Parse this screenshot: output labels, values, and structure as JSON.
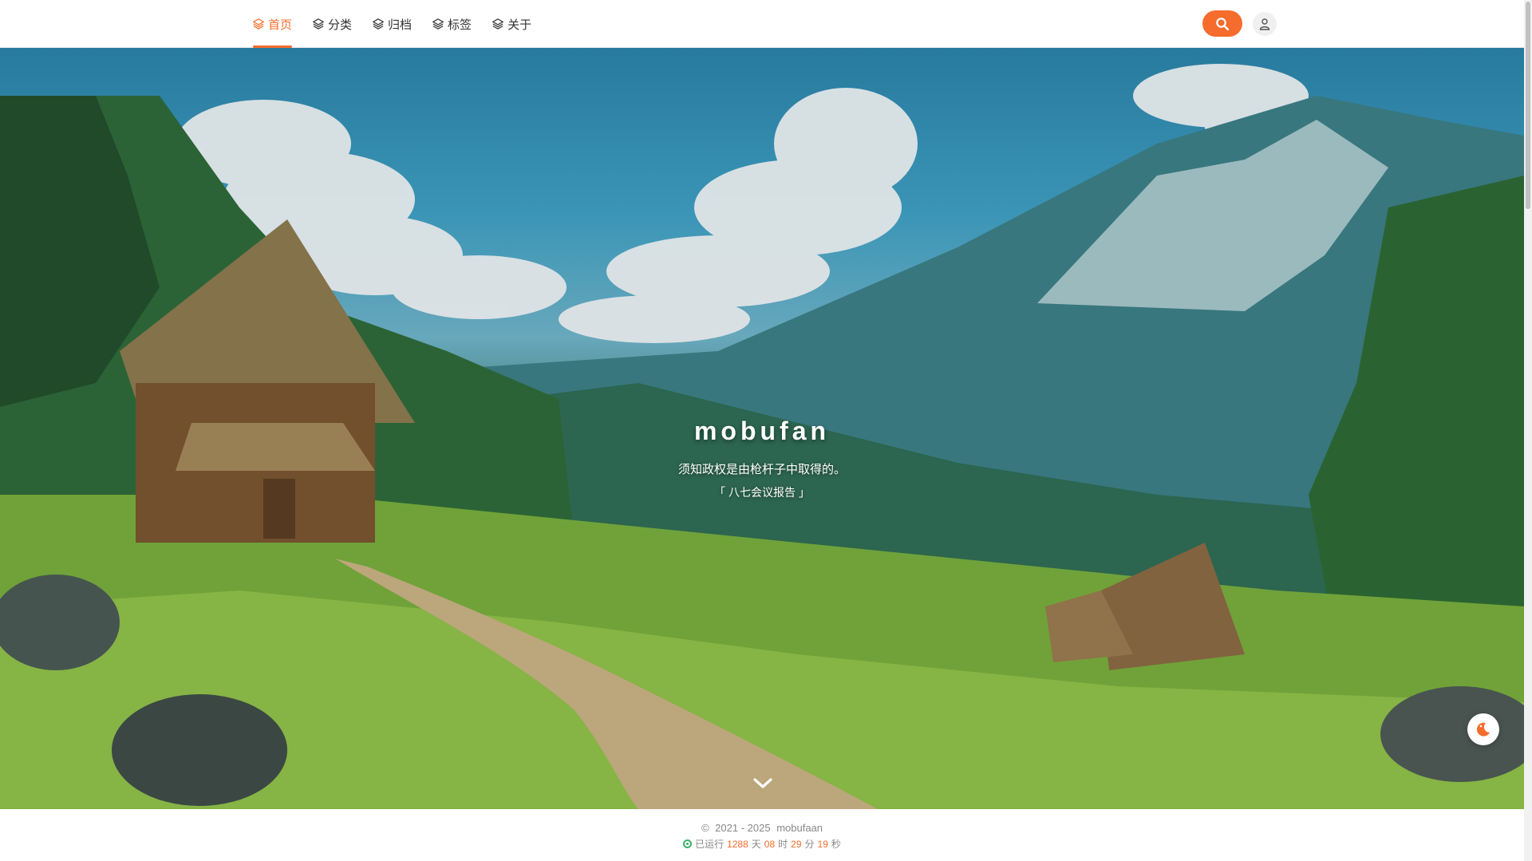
{
  "nav": {
    "items": [
      {
        "label": "首页",
        "icon": "layers-icon",
        "active": true
      },
      {
        "label": "分类",
        "icon": "layers-icon",
        "active": false
      },
      {
        "label": "归档",
        "icon": "layers-icon",
        "active": false
      },
      {
        "label": "标签",
        "icon": "layers-icon",
        "active": false
      },
      {
        "label": "关于",
        "icon": "layers-icon",
        "active": false
      }
    ],
    "search_icon": "search-icon",
    "user_icon": "user-icon"
  },
  "hero": {
    "title": "mobufan",
    "quote": "须知政权是由枪杆子中取得的。",
    "source": "「 八七会议报告 」",
    "scroll_icon": "chevron-down-icon"
  },
  "theme_toggle": {
    "icon": "moon-icon"
  },
  "footer": {
    "copyright_symbol": "©",
    "years": "2021 - 2025",
    "author": "mobufaan",
    "run_prefix": "已运行",
    "days": "1288",
    "days_unit": "天",
    "hours": "08",
    "hours_unit": "时",
    "minutes": "29",
    "minutes_unit": "分",
    "seconds": "19",
    "seconds_unit": "秒"
  },
  "colors": {
    "accent": "#f56c2d",
    "run_indicator": "#3bb36a"
  }
}
